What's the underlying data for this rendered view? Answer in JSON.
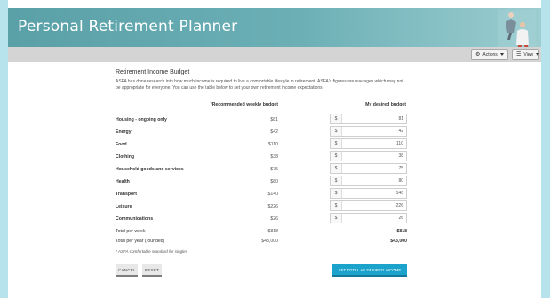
{
  "app": {
    "title": "Personal Retirement Planner"
  },
  "toolbar": {
    "actions_label": "Actions",
    "view_label": "View"
  },
  "section": {
    "title": "Retirement Income Budget",
    "description": "ASFA has done research into how much income is required to live a comfortable lifestyle in retirement. ASFA's figures are averages which may not be appropriate for everyone. You can use the table below to set your own retirement income expectations."
  },
  "table": {
    "col_recommended": "*Recommended weekly budget",
    "col_desired": "My desired budget",
    "currency": "$",
    "rows": [
      {
        "label": "Housing - ongoing only",
        "recommended": "$81",
        "desired": "81"
      },
      {
        "label": "Energy",
        "recommended": "$42",
        "desired": "42"
      },
      {
        "label": "Food",
        "recommended": "$110",
        "desired": "110"
      },
      {
        "label": "Clothing",
        "recommended": "$38",
        "desired": "38"
      },
      {
        "label": "Household goods and services",
        "recommended": "$75",
        "desired": "75"
      },
      {
        "label": "Health",
        "recommended": "$80",
        "desired": "80"
      },
      {
        "label": "Transport",
        "recommended": "$140",
        "desired": "140"
      },
      {
        "label": "Leisure",
        "recommended": "$226",
        "desired": "226"
      },
      {
        "label": "Communications",
        "recommended": "$26",
        "desired": "26"
      }
    ],
    "totals": [
      {
        "label": "Total per week",
        "recommended": "$818",
        "desired": "$818"
      },
      {
        "label": "Total per year (rounded)",
        "recommended": "$43,000",
        "desired": "$43,000"
      }
    ],
    "footnote": "* ASFA comfortable standard for singles"
  },
  "buttons": {
    "cancel": "CANCEL",
    "reset": "RESET",
    "set_total": "SET TOTAL AS DESIRED INCOME"
  },
  "colors": {
    "header": "#6cb0b6",
    "accent": "#1ba3cb",
    "toolbar": "#d4d4d4"
  }
}
